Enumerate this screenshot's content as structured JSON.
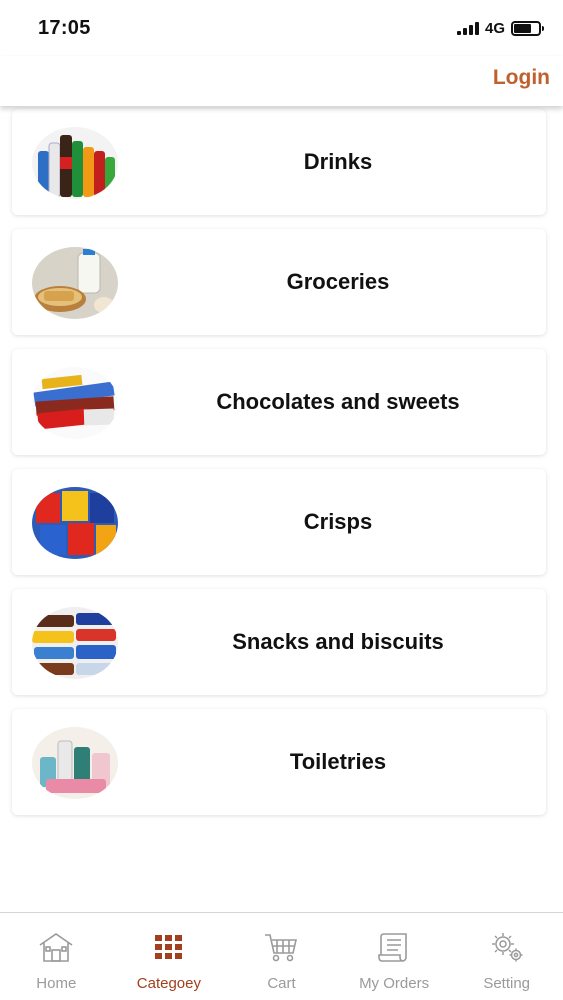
{
  "status_bar": {
    "time": "17:05",
    "network": "4G"
  },
  "header": {
    "login_label": "Login"
  },
  "categories": [
    {
      "label": "Drinks",
      "icon": "drinks-thumbnail"
    },
    {
      "label": "Groceries",
      "icon": "groceries-thumbnail"
    },
    {
      "label": "Chocolates and sweets",
      "icon": "chocolates-thumbnail"
    },
    {
      "label": "Crisps",
      "icon": "crisps-thumbnail"
    },
    {
      "label": "Snacks and biscuits",
      "icon": "biscuits-thumbnail"
    },
    {
      "label": "Toiletries",
      "icon": "toiletries-thumbnail"
    }
  ],
  "tabs": [
    {
      "label": "Home",
      "icon": "home-icon",
      "active": false
    },
    {
      "label": "Categoey",
      "icon": "grid-icon",
      "active": true
    },
    {
      "label": "Cart",
      "icon": "cart-icon",
      "active": false
    },
    {
      "label": "My Orders",
      "icon": "orders-icon",
      "active": false
    },
    {
      "label": "Setting",
      "icon": "gear-icon",
      "active": false
    }
  ],
  "colors": {
    "accent": "#c0602c",
    "active_tab": "#a0401f",
    "inactive_tab": "#9a9a9a"
  }
}
